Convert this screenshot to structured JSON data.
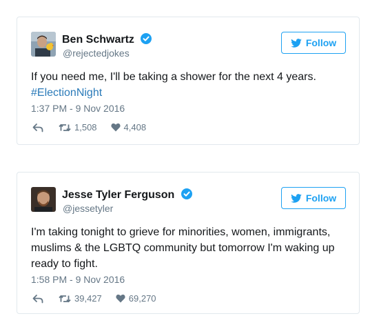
{
  "colors": {
    "accent": "#1da1f2",
    "hashtag": "#2b7bb9",
    "secondary_text": "#657786",
    "primary_text": "#14171a",
    "border": "#e1e8ed"
  },
  "tweets": [
    {
      "user": {
        "name": "Ben Schwartz",
        "handle": "@rejectedjokes",
        "verified": true,
        "avatar_icon": "avatar-photo"
      },
      "follow_label": "Follow",
      "text": "If you need me, I'll be taking a shower for the next 4 years.",
      "hashtag": "#ElectionNight",
      "timestamp": "1:37 PM - 9 Nov 2016",
      "actions": {
        "reply_icon": "reply-icon",
        "retweets": "1,508",
        "likes": "4,408"
      }
    },
    {
      "user": {
        "name": "Jesse Tyler Ferguson",
        "handle": "@jessetyler",
        "verified": true,
        "avatar_icon": "avatar-photo"
      },
      "follow_label": "Follow",
      "text": "I'm taking tonight to grieve for minorities, women, immigrants, muslims & the LGBTQ community but tomorrow I'm waking up ready to fight.",
      "timestamp": "1:58 PM - 9 Nov 2016",
      "actions": {
        "reply_icon": "reply-icon",
        "retweets": "39,427",
        "likes": "69,270"
      }
    }
  ]
}
